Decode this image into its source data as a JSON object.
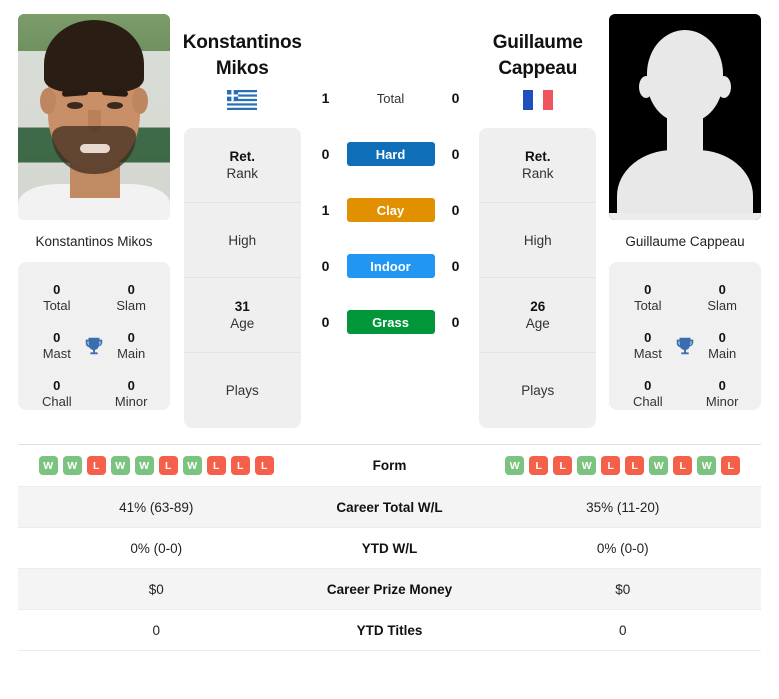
{
  "players": {
    "left": {
      "first_name": "Konstantinos",
      "last_name": "Mikos",
      "full_name": "Konstantinos Mikos",
      "flag": "greece-flag",
      "photo": "player-portrait-photo",
      "info": {
        "rank_value": "Ret.",
        "rank_label": "Rank",
        "high_label": "High",
        "high_value": "",
        "age_value": "31",
        "age_label": "Age",
        "plays_label": "Plays",
        "plays_value": ""
      },
      "titles": {
        "total_num": "0",
        "total_label": "Total",
        "slam_num": "0",
        "slam_label": "Slam",
        "mast_num": "0",
        "mast_label": "Mast",
        "main_num": "0",
        "main_label": "Main",
        "chall_num": "0",
        "chall_label": "Chall",
        "minor_num": "0",
        "minor_label": "Minor"
      },
      "form": [
        "W",
        "W",
        "L",
        "W",
        "W",
        "L",
        "W",
        "L",
        "L",
        "L"
      ],
      "career_total_wl": "41% (63-89)",
      "ytd_wl": "0% (0-0)",
      "career_prize_money": "$0",
      "ytd_titles": "0"
    },
    "right": {
      "first_name": "Guillaume",
      "last_name": "Cappeau",
      "full_name": "Guillaume Cappeau",
      "flag": "france-flag",
      "photo": "player-silhouette-placeholder",
      "info": {
        "rank_value": "Ret.",
        "rank_label": "Rank",
        "high_label": "High",
        "high_value": "",
        "age_value": "26",
        "age_label": "Age",
        "plays_label": "Plays",
        "plays_value": ""
      },
      "titles": {
        "total_num": "0",
        "total_label": "Total",
        "slam_num": "0",
        "slam_label": "Slam",
        "mast_num": "0",
        "mast_label": "Mast",
        "main_num": "0",
        "main_label": "Main",
        "chall_num": "0",
        "chall_label": "Chall",
        "minor_num": "0",
        "minor_label": "Minor"
      },
      "form": [
        "W",
        "L",
        "L",
        "W",
        "L",
        "L",
        "W",
        "L",
        "W",
        "L"
      ],
      "career_total_wl": "35% (11-20)",
      "ytd_wl": "0% (0-0)",
      "career_prize_money": "$0",
      "ytd_titles": "0"
    }
  },
  "head_to_head": {
    "rows": [
      {
        "label": "Total",
        "left": "1",
        "right": "0",
        "badge": false,
        "color": ""
      },
      {
        "label": "Hard",
        "left": "0",
        "right": "0",
        "badge": true,
        "color": "#0e6eb8"
      },
      {
        "label": "Clay",
        "left": "1",
        "right": "0",
        "badge": true,
        "color": "#e09000"
      },
      {
        "label": "Indoor",
        "left": "0",
        "right": "0",
        "badge": true,
        "color": "#2196f3"
      },
      {
        "label": "Grass",
        "left": "0",
        "right": "0",
        "badge": true,
        "color": "#009639"
      }
    ]
  },
  "compare_table": {
    "rows": [
      {
        "label": "Form",
        "type": "form"
      },
      {
        "label": "Career Total W/L",
        "type": "text",
        "key": "career_total_wl"
      },
      {
        "label": "YTD W/L",
        "type": "text",
        "key": "ytd_wl"
      },
      {
        "label": "Career Prize Money",
        "type": "text",
        "key": "career_prize_money"
      },
      {
        "label": "YTD Titles",
        "type": "text",
        "key": "ytd_titles"
      }
    ]
  },
  "colors": {
    "win_badge": "#7bc47f",
    "loss_badge": "#f4604a",
    "trophy": "#3b6eaf",
    "panel_bg": "#f0f0f0",
    "row_alt_bg": "#f4f4f4"
  },
  "icons": {
    "trophy": "trophy-icon"
  }
}
